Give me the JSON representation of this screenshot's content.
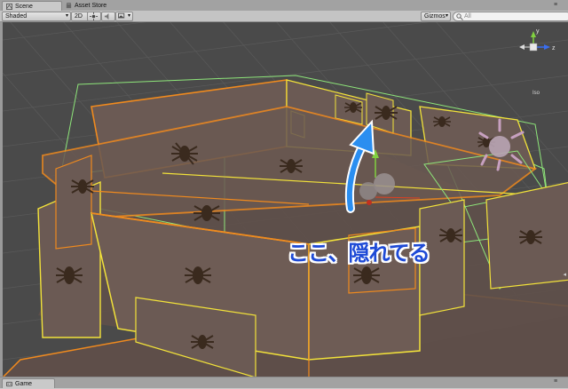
{
  "tabs": {
    "scene_label": "Scene",
    "asset_store_label": "Asset Store",
    "game_label": "Game"
  },
  "toolbar": {
    "shading_mode": "Shaded",
    "mode_2d": "2D",
    "sun_icon": "sun-icon",
    "audio_icon": "speaker-icon",
    "effects_icon": "image-icon",
    "gizmos_label": "Gizmos",
    "search_placeholder": "All"
  },
  "scene_gizmo": {
    "y_label": "y",
    "z_label": "z",
    "projection_label": "Iso",
    "y_color": "#80d040",
    "z_color": "#3a6ef0",
    "x_color": "#e04020"
  },
  "annotation": {
    "text": "ここ、隠れてる",
    "color": "#1e4ad6",
    "arrow_color": "#2a8ef0"
  },
  "scene_colors": {
    "background": "#4a4a4a",
    "wall_fill": "#6b5a54",
    "selected_outline": "#f08a1e",
    "child_outline": "#f2e23a",
    "collider_outline": "#8ee67a"
  }
}
